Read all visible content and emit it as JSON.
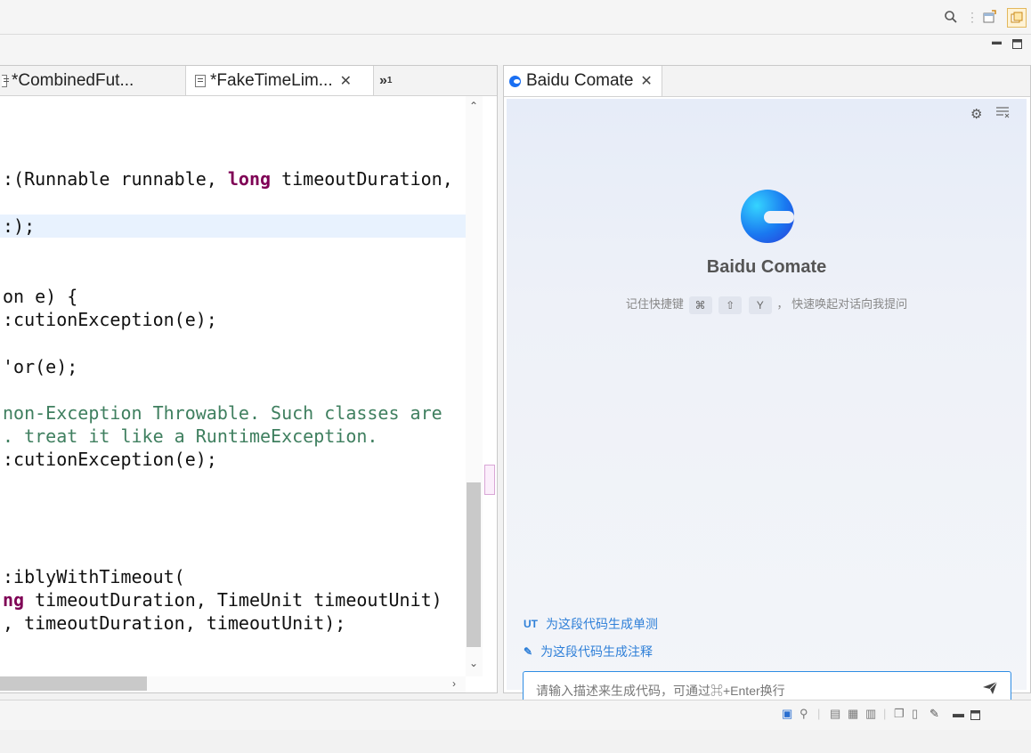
{
  "toolbar": {
    "search_icon": "search-icon",
    "perspective_icon": "open-perspective-icon",
    "java_perspective_icon": "java-perspective-icon"
  },
  "editor": {
    "tabs": [
      {
        "label": "*CombinedFut..."
      },
      {
        "label": "*FakeTimeLim..."
      }
    ],
    "overflow_label": "»",
    "overflow_count": "1",
    "code_lines": [
      {
        "pre": ":(Runnable runnable, ",
        "kw": "long",
        "post": " timeoutDuration,"
      },
      {
        "text": ":);"
      },
      {
        "text": "on e) {"
      },
      {
        "text": ":cutionException(e);"
      },
      {
        "text": "'or(e);"
      },
      {
        "comment": "non-Exception Throwable. Such classes are"
      },
      {
        "comment": ". treat it like a RuntimeException."
      },
      {
        "text": ":cutionException(e);"
      },
      {
        "text": ":iblyWithTimeout("
      },
      {
        "kwpart": "ng",
        "post": " timeoutDuration, TimeUnit timeoutUnit)"
      },
      {
        "text": ", timeoutDuration, timeoutUnit);"
      }
    ]
  },
  "comate": {
    "tab_label": "Baidu Comate",
    "title": "Baidu Comate",
    "shortcut_prefix": "记住快捷键",
    "keys": [
      "⌘",
      "⇧",
      "Y"
    ],
    "shortcut_sep": "，",
    "shortcut_suffix": "快速唤起对话向我提问",
    "actions": [
      {
        "icon": "UT",
        "label": "为这段代码生成单测"
      },
      {
        "icon": "✎",
        "label": "为这段代码生成注释"
      }
    ],
    "input_placeholder": "请输入描述来生成代码，可通过⌘+Enter换行"
  },
  "colors": {
    "accent": "#2e7fd8",
    "keyword": "#7f0055",
    "comment": "#3f7f5f"
  }
}
